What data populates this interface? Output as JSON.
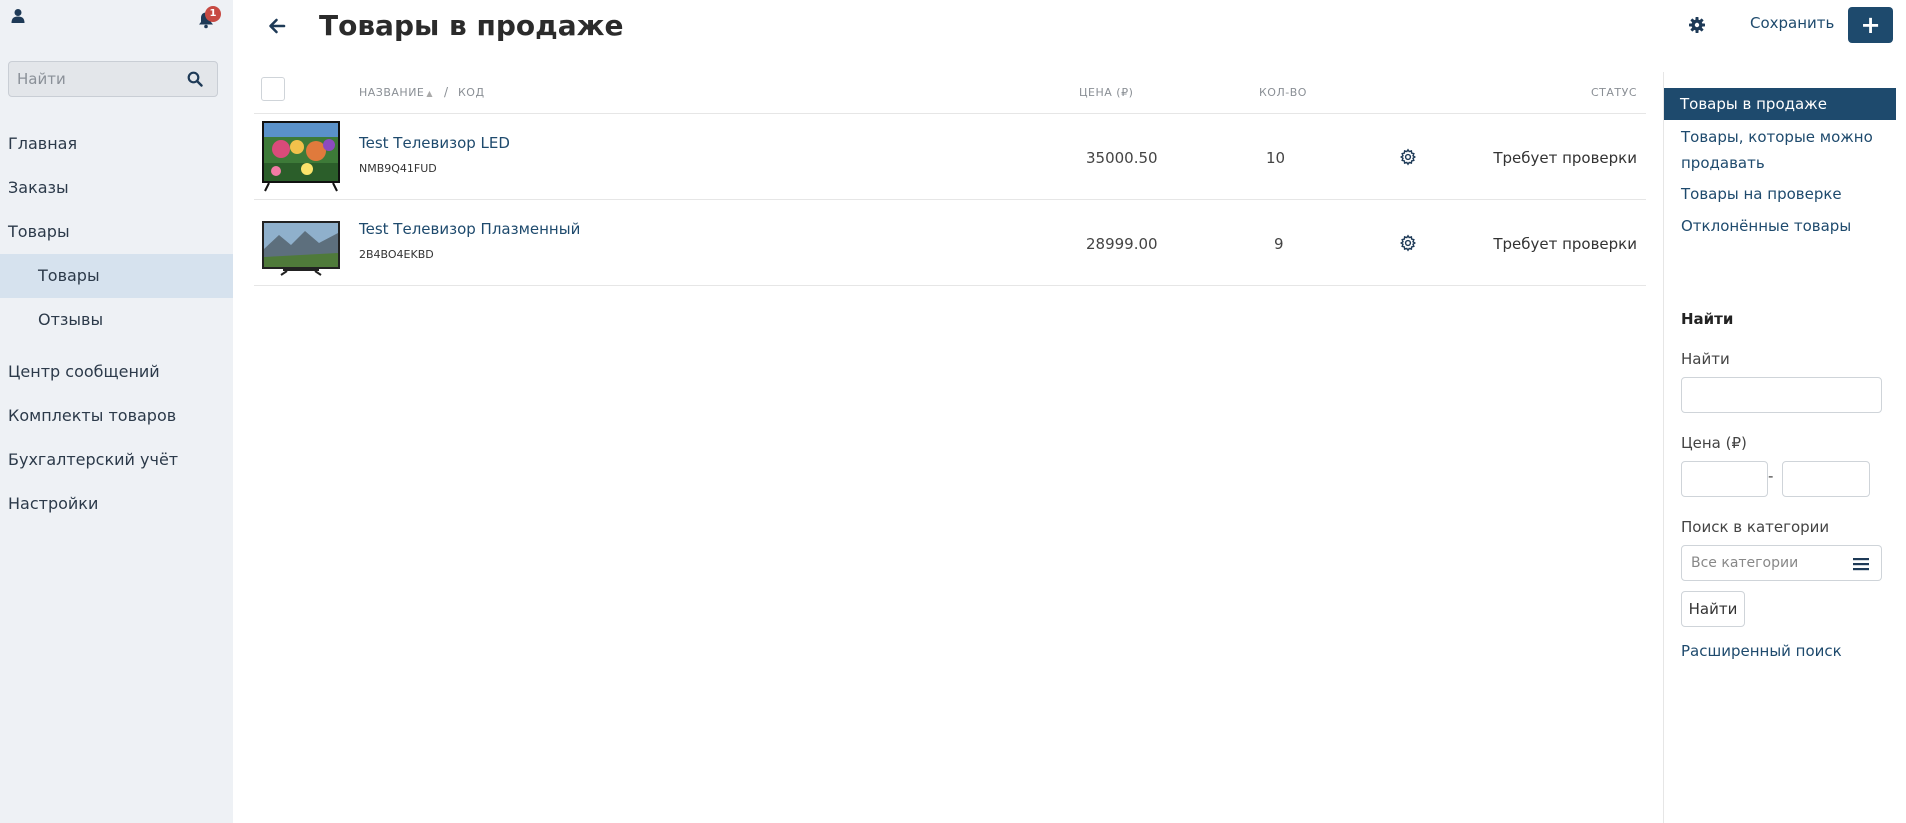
{
  "sidebar": {
    "notification_count": "1",
    "search_placeholder": "Найти",
    "nav": [
      {
        "label": "Главная"
      },
      {
        "label": "Заказы"
      },
      {
        "label": "Товары"
      },
      {
        "label": "Товары"
      },
      {
        "label": "Отзывы"
      },
      {
        "label": "Центр сообщений"
      },
      {
        "label": "Комплекты товаров"
      },
      {
        "label": "Бухгалтерский учёт"
      },
      {
        "label": "Настройки"
      }
    ]
  },
  "header": {
    "title": "Товары в продаже",
    "save_label": "Сохранить",
    "add_label": "+"
  },
  "table": {
    "columns": {
      "name": "НАЗВАНИЕ",
      "code": "КОД",
      "price": "ЦЕНА (₽)",
      "qty": "КОЛ-ВО",
      "status": "СТАТУС"
    },
    "rows": [
      {
        "name": "Test Телевизор LED",
        "code": "NMB9Q41FUD",
        "price": "35000.50",
        "qty": "10",
        "status": "Требует проверки"
      },
      {
        "name": "Test Телевизор Плазменный",
        "code": "2B4BO4EKBD",
        "price": "28999.00",
        "qty": "9",
        "status": "Требует проверки"
      }
    ]
  },
  "right_panel": {
    "links": [
      "Товары в продаже",
      "Товары, которые можно продавать",
      "Товары на проверке",
      "Отклонённые товары"
    ],
    "filter": {
      "title": "Найти",
      "search_label": "Найти",
      "price_label": "Цена (₽)",
      "price_separator": "-",
      "category_label": "Поиск в категории",
      "category_placeholder": "Все категории",
      "submit_label": "Найти",
      "advanced_label": "Расширенный поиск"
    }
  },
  "colors": {
    "accent": "#1e4a6d",
    "sidebar_bg": "#eef1f5",
    "sidebar_active": "#d6e2ee",
    "badge": "#c74a43"
  }
}
